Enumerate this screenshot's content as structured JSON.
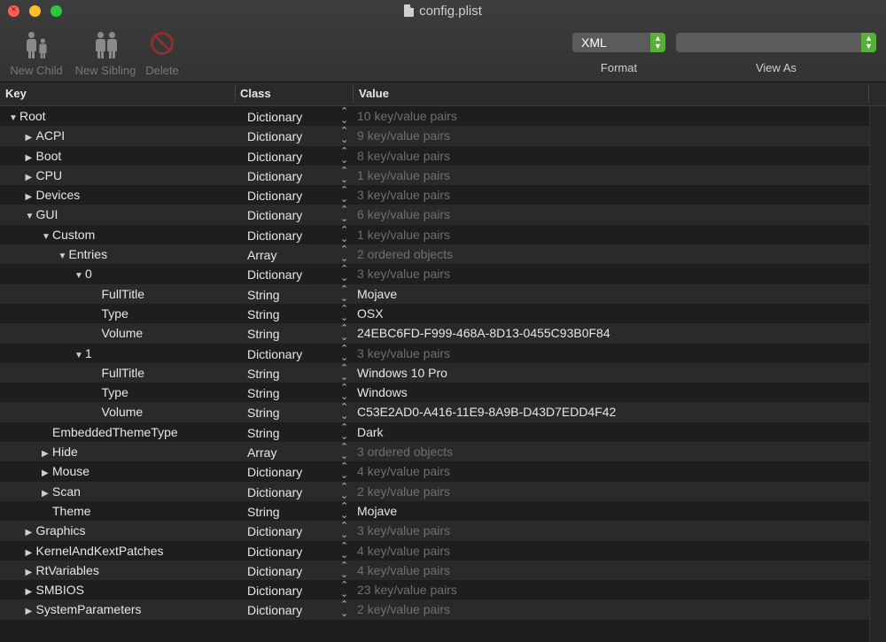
{
  "window": {
    "title": "config.plist"
  },
  "toolbar": {
    "new_child": "New Child",
    "new_sibling": "New Sibling",
    "delete": "Delete",
    "format_value": "XML",
    "format_label": "Format",
    "view_as_value": "",
    "view_as_label": "View As"
  },
  "columns": {
    "key": "Key",
    "class": "Class",
    "value": "Value"
  },
  "rows": [
    {
      "key": "Root",
      "class": "Dictionary",
      "value": "10 key/value pairs",
      "level": 0,
      "expander": "open",
      "dim": true
    },
    {
      "key": "ACPI",
      "class": "Dictionary",
      "value": "9 key/value pairs",
      "level": 1,
      "expander": "closed",
      "dim": true
    },
    {
      "key": "Boot",
      "class": "Dictionary",
      "value": "8 key/value pairs",
      "level": 1,
      "expander": "closed",
      "dim": true
    },
    {
      "key": "CPU",
      "class": "Dictionary",
      "value": "1 key/value pairs",
      "level": 1,
      "expander": "closed",
      "dim": true
    },
    {
      "key": "Devices",
      "class": "Dictionary",
      "value": "3 key/value pairs",
      "level": 1,
      "expander": "closed",
      "dim": true
    },
    {
      "key": "GUI",
      "class": "Dictionary",
      "value": "6 key/value pairs",
      "level": 1,
      "expander": "open",
      "dim": true
    },
    {
      "key": "Custom",
      "class": "Dictionary",
      "value": "1 key/value pairs",
      "level": 2,
      "expander": "open",
      "dim": true
    },
    {
      "key": "Entries",
      "class": "Array",
      "value": "2 ordered objects",
      "level": 3,
      "expander": "open",
      "dim": true
    },
    {
      "key": "0",
      "class": "Dictionary",
      "value": "3 key/value pairs",
      "level": 4,
      "expander": "open",
      "dim": true
    },
    {
      "key": "FullTitle",
      "class": "String",
      "value": "Mojave",
      "level": 5,
      "expander": "none",
      "dim": false
    },
    {
      "key": "Type",
      "class": "String",
      "value": "OSX",
      "level": 5,
      "expander": "none",
      "dim": false
    },
    {
      "key": "Volume",
      "class": "String",
      "value": "24EBC6FD-F999-468A-8D13-0455C93B0F84",
      "level": 5,
      "expander": "none",
      "dim": false
    },
    {
      "key": "1",
      "class": "Dictionary",
      "value": "3 key/value pairs",
      "level": 4,
      "expander": "open",
      "dim": true
    },
    {
      "key": "FullTitle",
      "class": "String",
      "value": "Windows 10 Pro",
      "level": 5,
      "expander": "none",
      "dim": false
    },
    {
      "key": "Type",
      "class": "String",
      "value": "Windows",
      "level": 5,
      "expander": "none",
      "dim": false
    },
    {
      "key": "Volume",
      "class": "String",
      "value": "C53E2AD0-A416-11E9-8A9B-D43D7EDD4F42",
      "level": 5,
      "expander": "none",
      "dim": false
    },
    {
      "key": "EmbeddedThemeType",
      "class": "String",
      "value": "Dark",
      "level": 2,
      "expander": "none",
      "dim": false
    },
    {
      "key": "Hide",
      "class": "Array",
      "value": "3 ordered objects",
      "level": 2,
      "expander": "closed",
      "dim": true
    },
    {
      "key": "Mouse",
      "class": "Dictionary",
      "value": "4 key/value pairs",
      "level": 2,
      "expander": "closed",
      "dim": true
    },
    {
      "key": "Scan",
      "class": "Dictionary",
      "value": "2 key/value pairs",
      "level": 2,
      "expander": "closed",
      "dim": true
    },
    {
      "key": "Theme",
      "class": "String",
      "value": "Mojave",
      "level": 2,
      "expander": "none",
      "dim": false
    },
    {
      "key": "Graphics",
      "class": "Dictionary",
      "value": "3 key/value pairs",
      "level": 1,
      "expander": "closed",
      "dim": true
    },
    {
      "key": "KernelAndKextPatches",
      "class": "Dictionary",
      "value": "4 key/value pairs",
      "level": 1,
      "expander": "closed",
      "dim": true
    },
    {
      "key": "RtVariables",
      "class": "Dictionary",
      "value": "4 key/value pairs",
      "level": 1,
      "expander": "closed",
      "dim": true
    },
    {
      "key": "SMBIOS",
      "class": "Dictionary",
      "value": "23 key/value pairs",
      "level": 1,
      "expander": "closed",
      "dim": true
    },
    {
      "key": "SystemParameters",
      "class": "Dictionary",
      "value": "2 key/value pairs",
      "level": 1,
      "expander": "closed",
      "dim": true
    }
  ]
}
